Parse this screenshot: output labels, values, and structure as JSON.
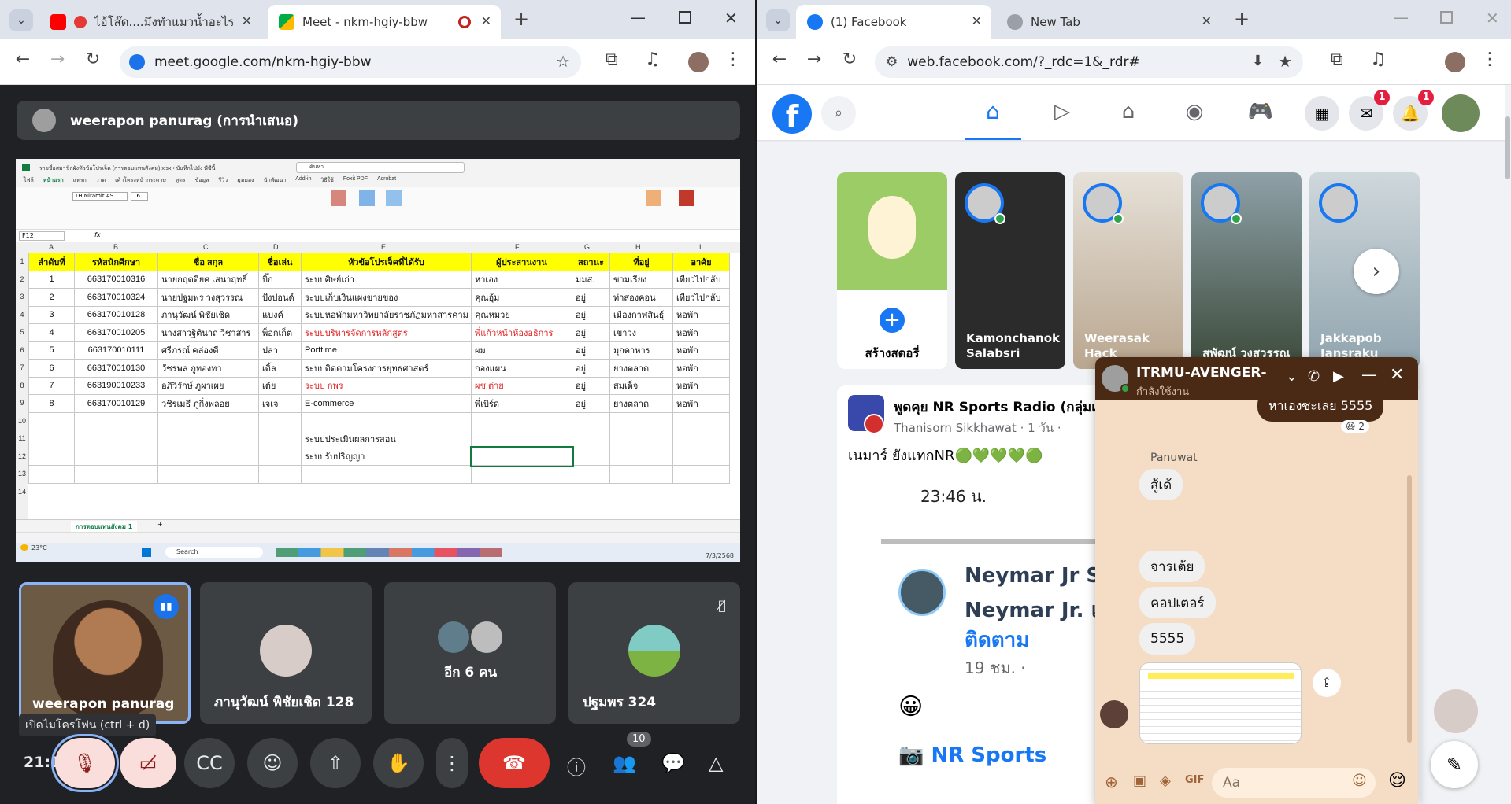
{
  "left_window": {
    "tabs": [
      {
        "title": "ไอ้โส๊ด....มึงทำแมวน้ำอะไร ??? | "
      },
      {
        "title": "Meet - nkm-hgiy-bbw"
      }
    ],
    "url": "meet.google.com/nkm-hgiy-bbw",
    "presenter_label": "weerapon panurag (การนำเสนอ)",
    "sheet": {
      "title": "รายชื่อสมาชิกผังหัวข้อโปรเจ็ค (การตอบแทนสังคม).xlsx • บันทึกไปยัง พีซีนี้",
      "search": "ค้นหา",
      "ribbon_tabs": [
        "ไฟล์",
        "หน้าแรก",
        "แทรก",
        "วาด",
        "เค้าโครงหน้ากระดาษ",
        "สูตร",
        "ข้อมูล",
        "รีวิว",
        "มุมมอง",
        "นักพัฒนา",
        "Add-in",
        "วิธีใช้",
        "Foxit PDF",
        "Acrobat"
      ],
      "namebox": "F12",
      "font": "TH Niramit AS",
      "fontsize": "16",
      "col_letters": [
        "A",
        "B",
        "C",
        "D",
        "E",
        "F",
        "G",
        "H",
        "I"
      ],
      "header": [
        "ลำดับที่",
        "รหัสนักศึกษา",
        "ชื่อ สกุล",
        "ชื่อเล่น",
        "หัวข้อโปรเจ็คที่ได้รับ",
        "ผู้ประสานงาน",
        "สถานะ",
        "ที่อยู่",
        "อาศัย"
      ],
      "rows": [
        [
          "1",
          "663170010316",
          "นายกฤตติยศ เสนาฤทธิ์",
          "บิ๊ก",
          "ระบบศิษย์เก่า",
          "หาเอง",
          "มมส.",
          "ขามเรียง",
          "เทียวไปกลับ"
        ],
        [
          "2",
          "663170010324",
          "นายปฐมพร วงสุวรรณ",
          "ปังปอนด์",
          "ระบบเก็บเงินแผงขายของ",
          "คุณอุ้ม",
          "อยู่",
          "ท่าสองคอน",
          "เทียวไปกลับ"
        ],
        [
          "3",
          "663170010128",
          "ภานุวัฒน์ พิชัยเชิด",
          "แบงค์",
          "ระบบหอพักมหาวิทยาลัยราชภัฏมหาสารคาม",
          "คุณหมวย",
          "อยู่",
          "เมืองกาฬสินธุ์",
          "หอพัก"
        ],
        [
          "4",
          "663170010205",
          "นางสาวฐิตินาถ วิชาสาร",
          "พ็อกเก็ต",
          "ระบบบริหารจัดการหลักสูตร",
          "พี่แก้วหน้าห้องอธิการ",
          "อยู่",
          "เขาวง",
          "หอพัก"
        ],
        [
          "5",
          "663170010111",
          "ศรีภรณ์ คล่องดี",
          "ปลา",
          "Porttime",
          "ผม",
          "อยู่",
          "มุกดาหาร",
          "หอพัก"
        ],
        [
          "6",
          "663170010130",
          "วัชรพล ภูทองทา",
          "เติ้ล",
          "ระบบติดตามโครงการยุทธศาสตร์",
          "กองแผน",
          "อยู่",
          "ยางตลาด",
          "หอพัก"
        ],
        [
          "7",
          "663190010233",
          "อภิวิรักษ์ ภูผาเผย",
          "เต้ย",
          "ระบบ กพร",
          "ผช.ต่าย",
          "อยู่",
          "สมเด็จ",
          "หอพัก"
        ],
        [
          "8",
          "663170010129",
          "วชิรเมธี ภูกิ่งพลอย",
          "เจเจ",
          "E-commerce",
          "พี่เบิร์ด",
          "อยู่",
          "ยางตลาด",
          "หอพัก"
        ]
      ],
      "extra": [
        "ระบบประเมินผลการสอน",
        "ระบบรับปริญญา"
      ],
      "row_numbers": [
        "1",
        "2",
        "3",
        "4",
        "5",
        "6",
        "7",
        "8",
        "9",
        "10",
        "11",
        "12",
        "13",
        "14"
      ],
      "sheet_tab": "การตอบแทนสังคม 1",
      "taskbar_weather": "23°C",
      "taskbar_search": "Search",
      "taskbar_date": "7/3/2568"
    },
    "participants": [
      {
        "name": "weerapon panurag"
      },
      {
        "name": "ภานุวัฒน์ พิชัยเชิด 128"
      },
      {
        "name": "อีก 6 คน"
      },
      {
        "name": "ปฐมพร 324"
      }
    ],
    "tooltip": "เปิดไมโครโฟน (ctrl + d)",
    "clock": "21:1",
    "people_count": "10"
  },
  "right_window": {
    "tabs": [
      {
        "title": "(1) Facebook"
      },
      {
        "title": "New Tab"
      }
    ],
    "url": "web.facebook.com/?_rdc=1&_rdr#",
    "messenger_badge": "1",
    "notif_badge": "1",
    "stories": [
      {
        "name": "สร้างสตอรี่"
      },
      {
        "name": "Kamonchanok Salabsri"
      },
      {
        "name": "Weerasak Hack"
      },
      {
        "name": "สุพัฒน์ วงสุวรรณ"
      },
      {
        "name": "Jakkapob Jansraku"
      }
    ],
    "post": {
      "page": "พูดคุย NR Sports Radio (กลุ่มเ",
      "author": "Thanisorn Sikkhawat · 1 วัน ·",
      "text": "เนมาร์ ยังแทกNR🟢💚💚💚🟢",
      "time": "23:46 น.",
      "inner_name": "Neymar Jr Sit",
      "inner_sub": "Neymar Jr. แล",
      "follow": "ติดตาม",
      "ago": "19 ชม. ·",
      "footer": "NR Sports"
    },
    "chat": {
      "title": "ITRMU-AVENGER-",
      "status": "กำลังใช้งาน",
      "top_bubble": "หาเองซะเลย 5555",
      "reaction_count": "2",
      "sender": "Panuwat",
      "messages": [
        "สู้เด้",
        "จารเต้ย",
        "คอปเตอร์",
        "5555"
      ],
      "input_placeholder": "Aa"
    }
  }
}
